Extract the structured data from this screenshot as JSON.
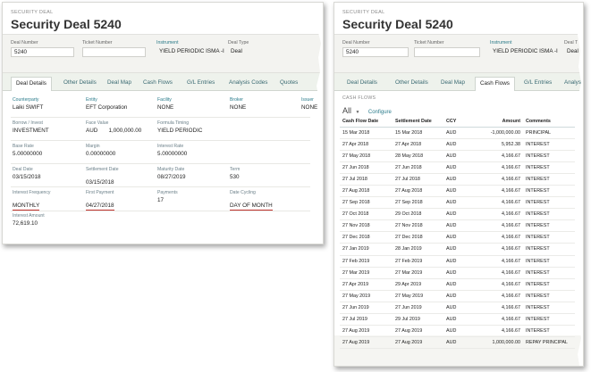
{
  "left": {
    "kicker": "SECURITY DEAL",
    "title": "Security Deal 5240",
    "fields": [
      {
        "label": "Deal Number",
        "value": "5240"
      },
      {
        "label": "Ticket Number",
        "value": ""
      },
      {
        "label": "Instrument",
        "value": "YIELD PERIODIC ISMA -I"
      },
      {
        "label": "Deal Type",
        "value": "Deal"
      }
    ],
    "tabs": [
      "Deal Details",
      "Other Details",
      "Deal Map",
      "Cash Flows",
      "G/L Entries",
      "Analysis Codes",
      "Quotes"
    ],
    "details": [
      {
        "label": "Counterparty",
        "value": "Laiki SWIFT"
      },
      {
        "label": "Entity",
        "value": "EFT Corporation"
      },
      {
        "label": "Facility",
        "value": "NONE"
      },
      {
        "label": "Broker",
        "value": "NONE"
      },
      {
        "label": "Issuer",
        "value": "NONE"
      },
      {
        "label": "Borrow / Invest",
        "value": "INVESTMENT"
      },
      {
        "label": "Face Value",
        "value": "AUD       1,000,000.00"
      },
      {
        "label": "Formula Timing",
        "value": "YIELD PERIODIC"
      },
      {
        "label": "Base Rate",
        "value": "5.00000000"
      },
      {
        "label": "Margin",
        "value": "0.00000000"
      },
      {
        "label": "Interest Rate",
        "value": "5.00000000"
      },
      {
        "label": "Deal Date",
        "value": "03/15/2018"
      },
      {
        "label": "Settlement Date",
        "value": "03/15/2018"
      },
      {
        "label": "Maturity Date",
        "value": "08/27/2019"
      },
      {
        "label": "Term",
        "value": "530"
      },
      {
        "label": "Interest Frequency",
        "value": "MONTHLY"
      },
      {
        "label": "First Payment",
        "value": "04/27/2018"
      },
      {
        "label": "Payments",
        "value": "17"
      },
      {
        "label": "Date Cycling",
        "value": "DAY OF MONTH"
      },
      {
        "label": "Interest Amount",
        "value": "72,619.10"
      }
    ]
  },
  "right": {
    "kicker": "SECURITY DEAL",
    "title": "Security Deal 5240",
    "fields": [
      {
        "label": "Deal Number",
        "value": "5240"
      },
      {
        "label": "Ticket Number",
        "value": ""
      },
      {
        "label": "Instrument",
        "value": "YIELD PERIODIC ISMA -I"
      },
      {
        "label": "Deal T",
        "value": "Deal"
      }
    ],
    "tabs": [
      "Deal Details",
      "Other Details",
      "Deal Map",
      "Cash Flows",
      "G/L Entries",
      "Analysis"
    ],
    "cashflows": {
      "section_label": "CASH FLOWS",
      "filter": "All",
      "configure": "Configure",
      "columns": [
        "Cash Flow Date",
        "Settlement Date",
        "CCY",
        "Amount",
        "Comments"
      ],
      "rows": [
        [
          "15 Mar 2018",
          "15 Mar 2018",
          "AUD",
          "-1,000,000.00",
          "PRINCIPAL"
        ],
        [
          "27 Apr 2018",
          "27 Apr 2018",
          "AUD",
          "5,952.38",
          "INTEREST"
        ],
        [
          "27 May 2018",
          "28 May 2018",
          "AUD",
          "4,166.67",
          "INTEREST"
        ],
        [
          "27 Jun 2018",
          "27 Jun 2018",
          "AUD",
          "4,166.67",
          "INTEREST"
        ],
        [
          "27 Jul 2018",
          "27 Jul 2018",
          "AUD",
          "4,166.67",
          "INTEREST"
        ],
        [
          "27 Aug 2018",
          "27 Aug 2018",
          "AUD",
          "4,166.67",
          "INTEREST"
        ],
        [
          "27 Sep 2018",
          "27 Sep 2018",
          "AUD",
          "4,166.67",
          "INTEREST"
        ],
        [
          "27 Oct 2018",
          "29 Oct 2018",
          "AUD",
          "4,166.67",
          "INTEREST"
        ],
        [
          "27 Nov 2018",
          "27 Nov 2018",
          "AUD",
          "4,166.67",
          "INTEREST"
        ],
        [
          "27 Dec 2018",
          "27 Dec 2018",
          "AUD",
          "4,166.67",
          "INTEREST"
        ],
        [
          "27 Jan 2019",
          "28 Jan 2019",
          "AUD",
          "4,166.67",
          "INTEREST"
        ],
        [
          "27 Feb 2019",
          "27 Feb 2019",
          "AUD",
          "4,166.67",
          "INTEREST"
        ],
        [
          "27 Mar 2019",
          "27 Mar 2019",
          "AUD",
          "4,166.67",
          "INTEREST"
        ],
        [
          "27 Apr 2019",
          "29 Apr 2019",
          "AUD",
          "4,166.67",
          "INTEREST"
        ],
        [
          "27 May 2019",
          "27 May 2019",
          "AUD",
          "4,166.67",
          "INTEREST"
        ],
        [
          "27 Jun 2019",
          "27 Jun 2019",
          "AUD",
          "4,166.67",
          "INTEREST"
        ],
        [
          "27 Jul 2019",
          "29 Jul 2019",
          "AUD",
          "4,166.67",
          "INTEREST"
        ],
        [
          "27 Aug 2019",
          "27 Aug 2019",
          "AUD",
          "4,166.67",
          "INTEREST"
        ],
        [
          "27 Aug 2019",
          "27 Aug 2019",
          "AUD",
          "1,000,000.00",
          "REPAY PRINCIPAL"
        ]
      ]
    }
  },
  "colors": {
    "tab_link": "#3a6a72",
    "label_blue": "#2b7c8c",
    "underline_red": "#c0302b",
    "tab_bar_bg": "#eef2ec"
  }
}
